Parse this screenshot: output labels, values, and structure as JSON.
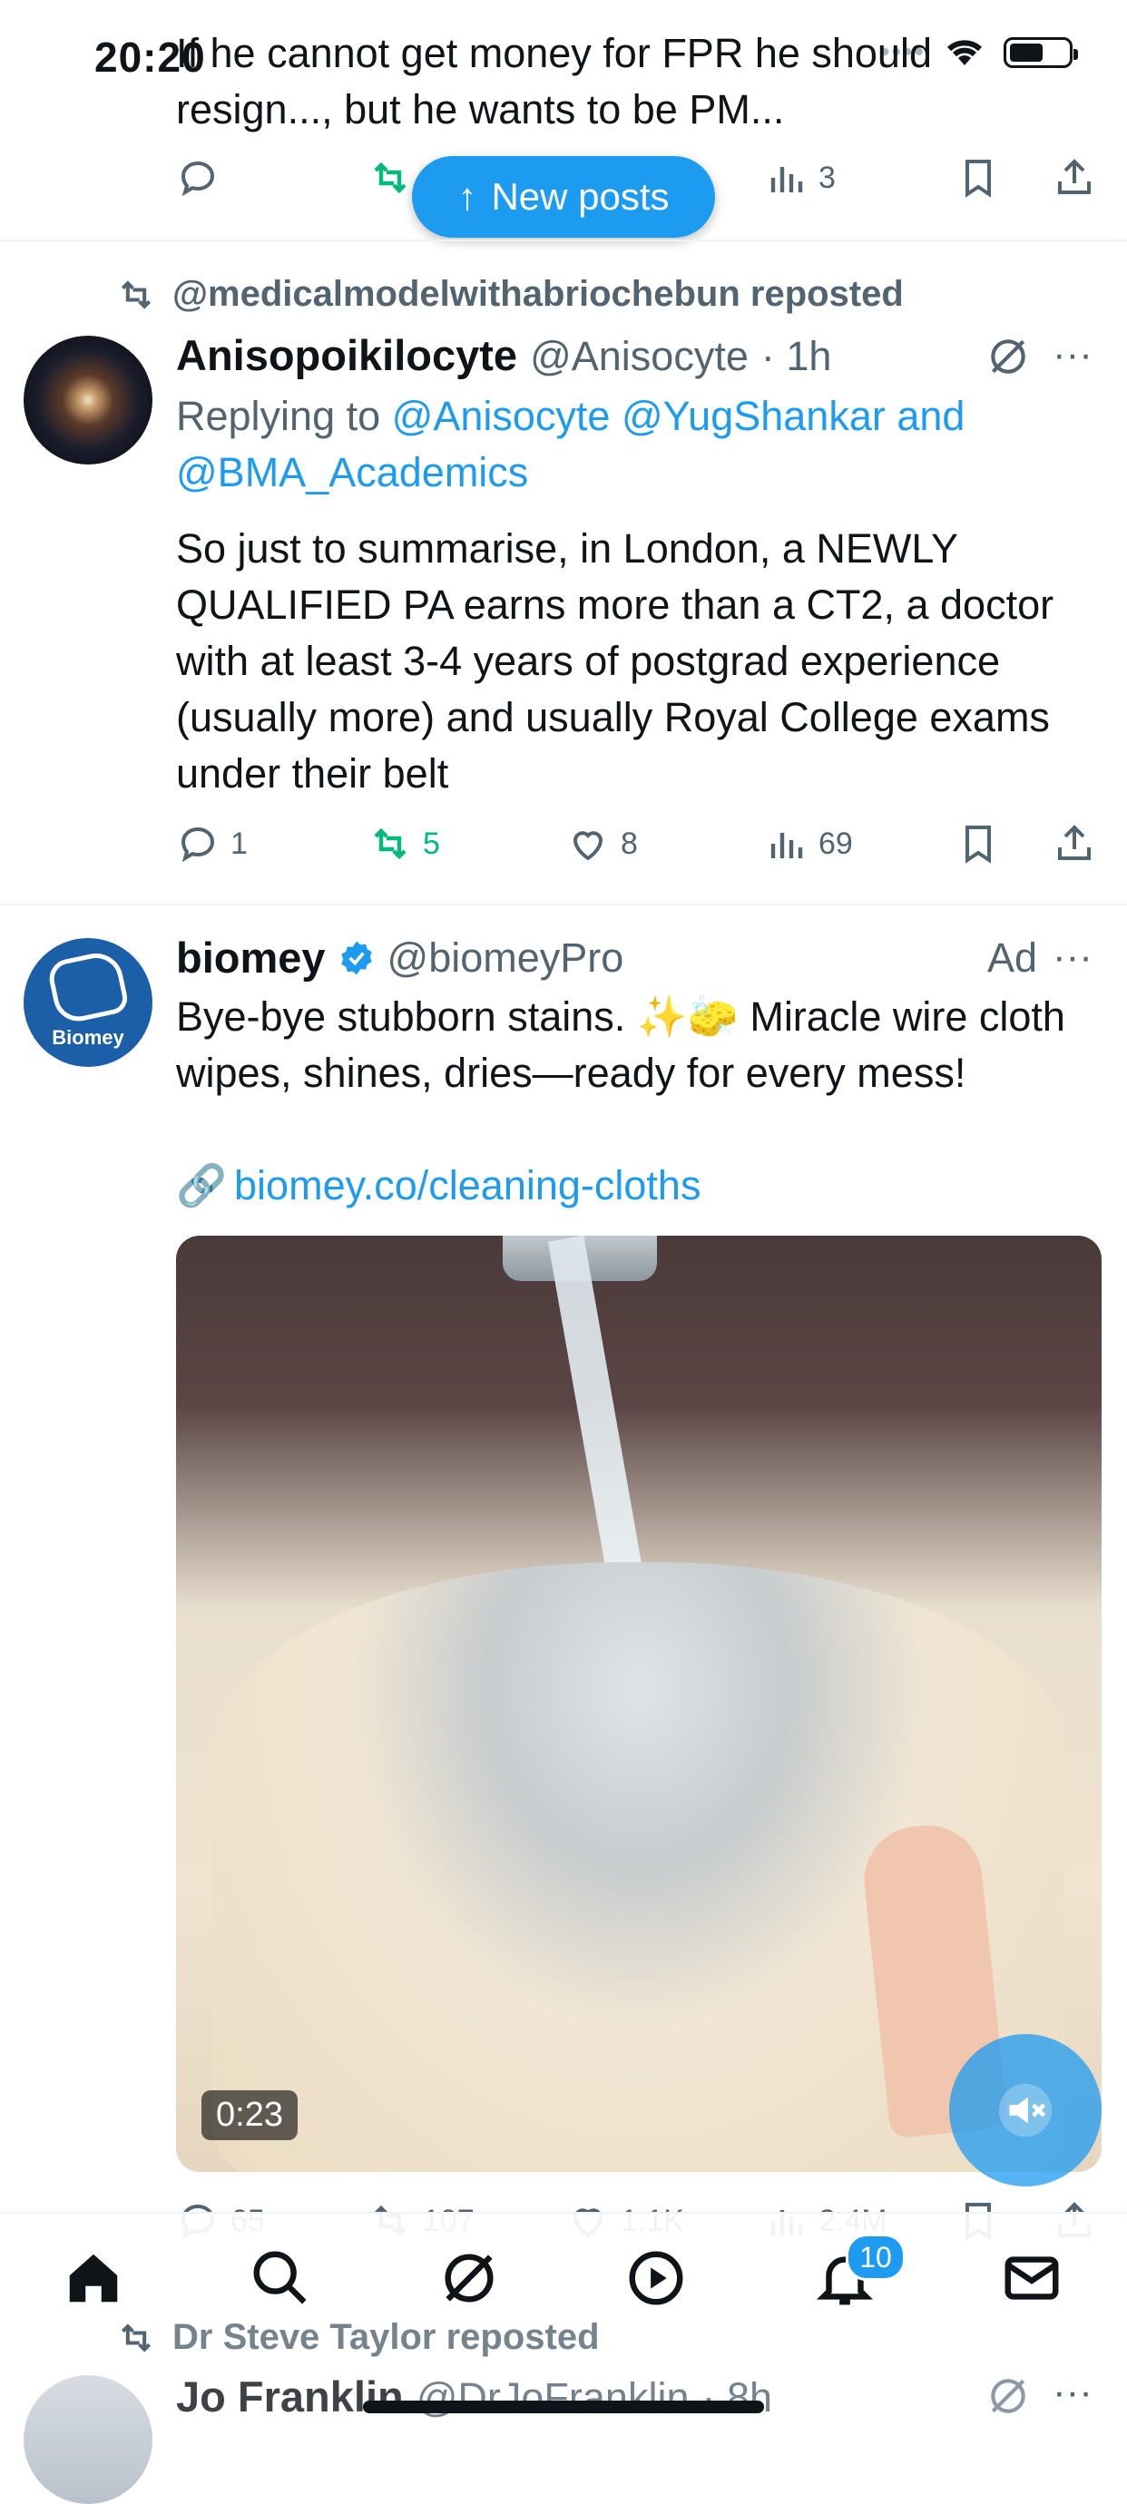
{
  "status_bar": {
    "time": "20:20"
  },
  "prev_tweet": {
    "text_line1": "If he cannot get money for FPR he should",
    "text_line2": "resign..., but he wants to be PM...",
    "views": "3"
  },
  "new_posts_label": "New posts",
  "tweet1": {
    "repost_by": "@medicalmodelwithabriochebun reposted",
    "name": "Anisopoikilocyte",
    "handle": "@Anisocyte",
    "time": "· 1h",
    "reply_prefix": "Replying to",
    "reply_to_1": "@Anisocyte",
    "reply_to_2": "@YugShankar",
    "reply_and": "and",
    "reply_to_3": "@BMA_Academics",
    "text": "So just to summarise, in London, a NEWLY QUALIFIED PA earns more than a CT2, a doctor with at least 3-4 years of postgrad experience (usually more) and usually Royal College exams under their belt",
    "replies": "1",
    "reposts": "5",
    "likes": "8",
    "views": "69"
  },
  "tweet2": {
    "avatar_text": "Biomey",
    "name": "biomey",
    "handle": "@biomeyPro",
    "ad_label": "Ad",
    "text": "Bye-bye stubborn stains. ✨🧽 Miracle wire cloth wipes, shines, dries—ready for every mess!",
    "link_emoji": "🔗",
    "link": "biomey.co/cleaning-cloths",
    "video_time": "0:23",
    "replies": "65",
    "reposts": "107",
    "likes": "1.1K",
    "views": "2.4M"
  },
  "tweet3": {
    "repost_by": "Dr Steve Taylor reposted",
    "name": "Jo Franklin",
    "handle": "@DrJoFranklin",
    "time": "· 8h"
  },
  "nav": {
    "notifications_badge": "10"
  },
  "colors": {
    "accent": "#1d9bf0",
    "repost_green": "#00ba7c",
    "muted": "#536471",
    "text": "#0f1419"
  }
}
